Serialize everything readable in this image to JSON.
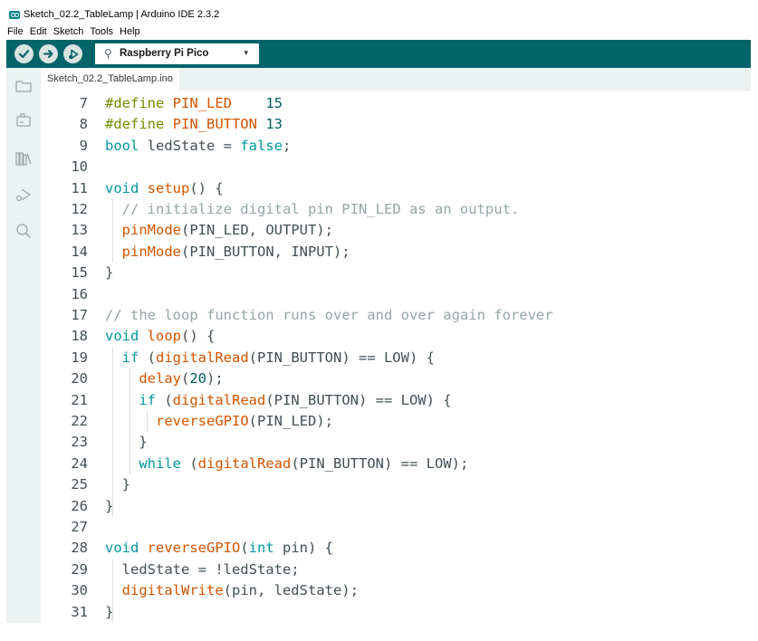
{
  "window": {
    "title": "Sketch_02.2_TableLamp | Arduino IDE 2.3.2"
  },
  "menu": [
    "File",
    "Edit",
    "Sketch",
    "Tools",
    "Help"
  ],
  "toolbar": {
    "verify_icon": "check-icon",
    "upload_icon": "arrow-right-icon",
    "debug_icon": "debugger-icon",
    "board_icon": "usb-icon",
    "board_name": "Raspberry Pi Pico",
    "board_caret": "▾"
  },
  "sidebar": {
    "icons": [
      "folder-icon",
      "boards-manager-icon",
      "library-icon",
      "debug-icon",
      "search-icon"
    ]
  },
  "tabs": [
    {
      "label": "Sketch_02.2_TableLamp.ino",
      "active": true
    }
  ],
  "editor": {
    "lines": [
      {
        "n": "7",
        "tokens": [
          [
            "k-pp",
            "#define "
          ],
          [
            "k-const",
            "PIN_LED"
          ],
          [
            "k-def",
            "    "
          ],
          [
            "k-num",
            "15"
          ]
        ]
      },
      {
        "n": "8",
        "tokens": [
          [
            "k-pp",
            "#define "
          ],
          [
            "k-const",
            "PIN_BUTTON"
          ],
          [
            "k-def",
            " "
          ],
          [
            "k-num",
            "13"
          ]
        ]
      },
      {
        "n": "9",
        "tokens": [
          [
            "k-type",
            "bool"
          ],
          [
            "k-def",
            " ledState = "
          ],
          [
            "k-type",
            "false"
          ],
          [
            "k-def",
            ";"
          ]
        ]
      },
      {
        "n": "10",
        "tokens": []
      },
      {
        "n": "11",
        "tokens": [
          [
            "k-type",
            "void"
          ],
          [
            "k-def",
            " "
          ],
          [
            "k-fn",
            "setup"
          ],
          [
            "k-def",
            "() {"
          ]
        ]
      },
      {
        "n": "12",
        "tokens": [
          [
            "k-cm",
            "  // initialize digital pin PIN_LED as an output."
          ]
        ]
      },
      {
        "n": "13",
        "tokens": [
          [
            "k-def",
            "  "
          ],
          [
            "k-fn",
            "pinMode"
          ],
          [
            "k-def",
            "(PIN_LED, OUTPUT);"
          ]
        ]
      },
      {
        "n": "14",
        "tokens": [
          [
            "k-def",
            "  "
          ],
          [
            "k-fn",
            "pinMode"
          ],
          [
            "k-def",
            "(PIN_BUTTON, INPUT);"
          ]
        ]
      },
      {
        "n": "15",
        "tokens": [
          [
            "k-def",
            "}"
          ]
        ]
      },
      {
        "n": "16",
        "tokens": []
      },
      {
        "n": "17",
        "tokens": [
          [
            "k-cm",
            "// the loop function runs over and over again forever"
          ]
        ]
      },
      {
        "n": "18",
        "tokens": [
          [
            "k-type",
            "void"
          ],
          [
            "k-def",
            " "
          ],
          [
            "k-fn",
            "loop"
          ],
          [
            "k-def",
            "() {"
          ]
        ]
      },
      {
        "n": "19",
        "tokens": [
          [
            "k-def",
            "  "
          ],
          [
            "k-type",
            "if"
          ],
          [
            "k-def",
            " ("
          ],
          [
            "k-fn",
            "digitalRead"
          ],
          [
            "k-def",
            "(PIN_BUTTON) == LOW) {"
          ]
        ]
      },
      {
        "n": "20",
        "tokens": [
          [
            "k-def",
            "    "
          ],
          [
            "k-fn",
            "delay"
          ],
          [
            "k-def",
            "("
          ],
          [
            "k-num",
            "20"
          ],
          [
            "k-def",
            ");"
          ]
        ]
      },
      {
        "n": "21",
        "tokens": [
          [
            "k-def",
            "    "
          ],
          [
            "k-type",
            "if"
          ],
          [
            "k-def",
            " ("
          ],
          [
            "k-fn",
            "digitalRead"
          ],
          [
            "k-def",
            "(PIN_BUTTON) == LOW) {"
          ]
        ]
      },
      {
        "n": "22",
        "tokens": [
          [
            "k-def",
            "      "
          ],
          [
            "k-fn",
            "reverseGPIO"
          ],
          [
            "k-def",
            "(PIN_LED);"
          ]
        ]
      },
      {
        "n": "23",
        "tokens": [
          [
            "k-def",
            "    }"
          ]
        ]
      },
      {
        "n": "24",
        "tokens": [
          [
            "k-def",
            "    "
          ],
          [
            "k-type",
            "while"
          ],
          [
            "k-def",
            " ("
          ],
          [
            "k-fn",
            "digitalRead"
          ],
          [
            "k-def",
            "(PIN_BUTTON) == LOW);"
          ]
        ]
      },
      {
        "n": "25",
        "tokens": [
          [
            "k-def",
            "  }"
          ]
        ]
      },
      {
        "n": "26",
        "tokens": [
          [
            "k-def",
            "}"
          ]
        ]
      },
      {
        "n": "27",
        "tokens": []
      },
      {
        "n": "28",
        "tokens": [
          [
            "k-type",
            "void"
          ],
          [
            "k-def",
            " "
          ],
          [
            "k-fn",
            "reverseGPIO"
          ],
          [
            "k-def",
            "("
          ],
          [
            "k-type",
            "int"
          ],
          [
            "k-def",
            " pin) {"
          ]
        ]
      },
      {
        "n": "29",
        "tokens": [
          [
            "k-def",
            "  ledState = !ledState;"
          ]
        ]
      },
      {
        "n": "30",
        "tokens": [
          [
            "k-def",
            "  "
          ],
          [
            "k-fn",
            "digitalWrite"
          ],
          [
            "k-def",
            "(pin, ledState);"
          ]
        ]
      },
      {
        "n": "31",
        "tokens": [
          [
            "k-def",
            "}"
          ]
        ]
      }
    ]
  },
  "colors": {
    "toolbar": "#006468",
    "sidebar": "#ecf1f1",
    "keyword": "#00979c",
    "function": "#d35400",
    "preprocessor": "#728e00",
    "comment": "#95a5a6",
    "number": "#005c5f"
  }
}
